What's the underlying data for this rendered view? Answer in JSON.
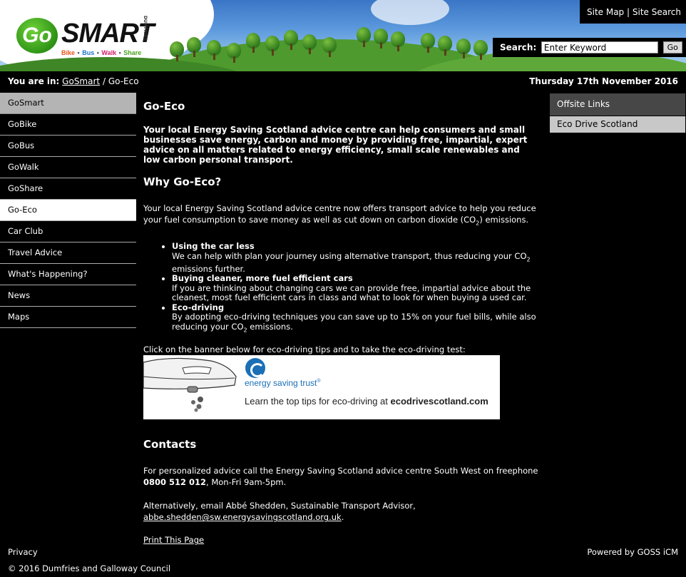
{
  "colors": {
    "background": "#000000",
    "nav_top_bg": "#b4b4b4",
    "nav_active_bg": "#ffffff",
    "offsite_title_bg": "#474747",
    "offsite_link_bg": "#c8c8c8",
    "logo_green": "#2a8f12"
  },
  "logo": {
    "go": "Go",
    "smart": "SMART",
    "dumfries": "DUMFRIES",
    "tag": {
      "bike": "Bike",
      "bus": "Bus",
      "walk": "Walk",
      "share": "Share",
      "sep": "•"
    }
  },
  "top_links": {
    "site_map": "Site Map",
    "sep": "|",
    "site_search": "Site Search"
  },
  "search": {
    "label": "Search:",
    "placeholder": "Enter Keyword",
    "button": "Go"
  },
  "breadcrumb": {
    "prefix": "You are in:",
    "home": "GoSmart",
    "sep": "/",
    "current": "Go-Eco"
  },
  "date": "Thursday 17th November 2016",
  "nav": [
    "GoSmart",
    "GoBike",
    "GoBus",
    "GoWalk",
    "GoShare",
    "Go-Eco",
    "Car Club",
    "Travel Advice",
    "What's Happening?",
    "News",
    "Maps"
  ],
  "offsite": {
    "title": "Offsite Links",
    "link": "Eco Drive Scotland"
  },
  "main": {
    "title": "Go-Eco",
    "intro": "Your local Energy Saving Scotland advice centre can help consumers and small businesses save energy, carbon and money by providing free, impartial, expert advice on all matters related to energy efficiency, small scale renewables and low carbon personal transport.",
    "why_heading": "Why Go-Eco?",
    "why_text_a": "Your local Energy Saving Scotland advice centre now offers transport advice to help you reduce your fuel consumption to save money as well as cut down on carbon dioxide (CO",
    "why_text_sub": "2",
    "why_text_b": ") emissions.",
    "bullets": [
      {
        "title": "Using the car less",
        "text_a": "We can help with plan your journey using alternative transport, thus reducing your CO",
        "sub": "2",
        "text_b": " emissions further."
      },
      {
        "title": "Buying cleaner, more fuel efficient cars",
        "text_a": "If you are thinking about changing cars we can provide free, impartial advice about the cleanest, most fuel efficient cars in class and what to look for when buying a used car.",
        "sub": "",
        "text_b": ""
      },
      {
        "title": "Eco-driving",
        "text_a": "By adopting eco-driving techniques you can save up to 15% on your fuel bills, while also reducing your CO",
        "sub": "2",
        "text_b": " emissions."
      }
    ],
    "banner_intro": "Click on the banner below for eco-driving tips and to take the eco-driving test:",
    "banner": {
      "org": "energy saving trust",
      "reg": "®",
      "text_a": "Learn the top tips for eco-driving at ",
      "text_b": "ecodrivescotland.com"
    },
    "contacts_heading": "Contacts",
    "contact_1a": "For personalized advice call the Energy Saving Scotland advice centre South West on freephone ",
    "contact_1_phone": "0800 512 012",
    "contact_1b": ", Mon-Fri 9am-5pm.",
    "contact_2a": "Alternatively, email Abbé Shedden, Sustainable Transport Advisor, ",
    "contact_2_email": "abbe.shedden@sw.energysavingscotland.org.uk",
    "contact_2b": ".",
    "print": "Print This Page"
  },
  "footer": {
    "privacy": "Privacy",
    "powered": "Powered by GOSS iCM",
    "copyright": "© 2016 Dumfries and Galloway Council"
  }
}
